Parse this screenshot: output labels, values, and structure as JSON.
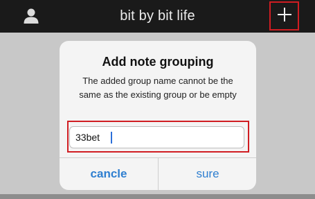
{
  "header": {
    "title": "bit by bit life",
    "left_icon": "user-icon",
    "right_icon": "plus-icon"
  },
  "dialog": {
    "title": "Add note grouping",
    "message": "The added group name cannot be the same as the existing group or be empty",
    "input_value": "33bet",
    "cancel_label": "cancle",
    "confirm_label": "sure"
  },
  "colors": {
    "topbar": "#1a1a1a",
    "overlay": "#c8c8c8",
    "dialog": "#f4f4f4",
    "accent": "#2f7fd0",
    "highlight": "#d01d22"
  }
}
